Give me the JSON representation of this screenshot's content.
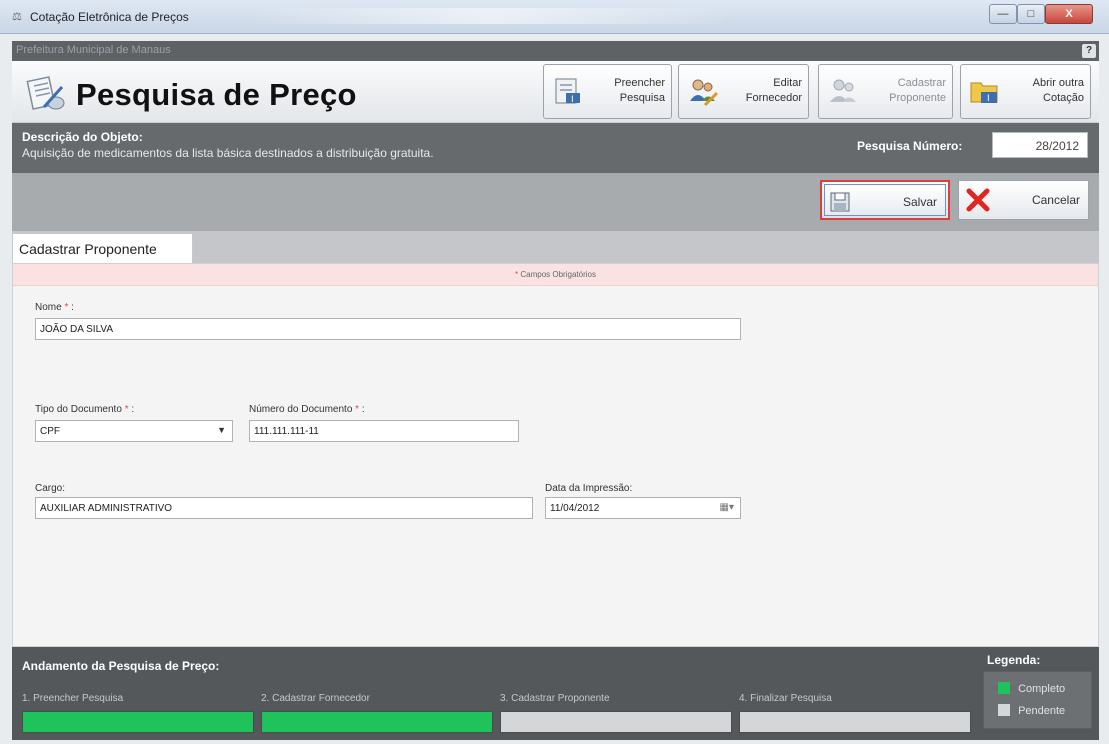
{
  "window": {
    "title": "Cotação Eletrônica de Preços",
    "app_icon": "scale-icon",
    "buttons": {
      "minimize": "—",
      "maximize": "□",
      "close": "X"
    }
  },
  "org": {
    "name": "Prefeitura Municipal de Manaus",
    "help_label": "?"
  },
  "header": {
    "title": "Pesquisa de Preço",
    "toolbar": [
      {
        "label": "Preencher\nPesquisa",
        "icon": "edit-form-icon",
        "enabled": true
      },
      {
        "label": "Editar\nFornecedor",
        "icon": "users-edit-icon",
        "enabled": true
      },
      {
        "label": "Cadastrar\nProponente",
        "icon": "add-user-icon",
        "enabled": false
      },
      {
        "label": "Abrir outra\nCotação",
        "icon": "open-folder-icon",
        "enabled": true
      }
    ]
  },
  "description": {
    "label": "Descrição do Objeto:",
    "text": "Aquisição de medicamentos da lista básica destinados a distribuição gratuita.",
    "number_label": "Pesquisa Número:",
    "number_value": "28/2012"
  },
  "actions": {
    "save_label": "Salvar",
    "cancel_label": "Cancelar"
  },
  "tab": {
    "label": "Cadastrar Proponente"
  },
  "form": {
    "required_note": "Campos Obrigatórios",
    "required_mark": "*",
    "nome_label": "Nome",
    "nome_value": "JOÃO DA SILVA",
    "tipo_doc_label": "Tipo do Documento",
    "tipo_doc_value": "CPF",
    "num_doc_label": "Número do Documento",
    "num_doc_value": "111.111.111-11",
    "cargo_label": "Cargo:",
    "cargo_value": "AUXILIAR ADMINISTRATIVO",
    "data_label": "Data da Impressão:",
    "data_value": "11/04/2012",
    "colon": ":"
  },
  "progress": {
    "title": "Andamento da Pesquisa de Preço:",
    "steps": [
      {
        "label": "1. Preencher Pesquisa",
        "status": "complete"
      },
      {
        "label": "2. Cadastrar Fornecedor",
        "status": "complete"
      },
      {
        "label": "3. Cadastrar Proponente",
        "status": "pending"
      },
      {
        "label": "4. Finalizar Pesquisa",
        "status": "pending"
      }
    ],
    "legend_title": "Legenda:",
    "legend": [
      {
        "label": "Completo",
        "color": "#1fc25b"
      },
      {
        "label": "Pendente",
        "color": "#d4d6d8"
      }
    ]
  }
}
